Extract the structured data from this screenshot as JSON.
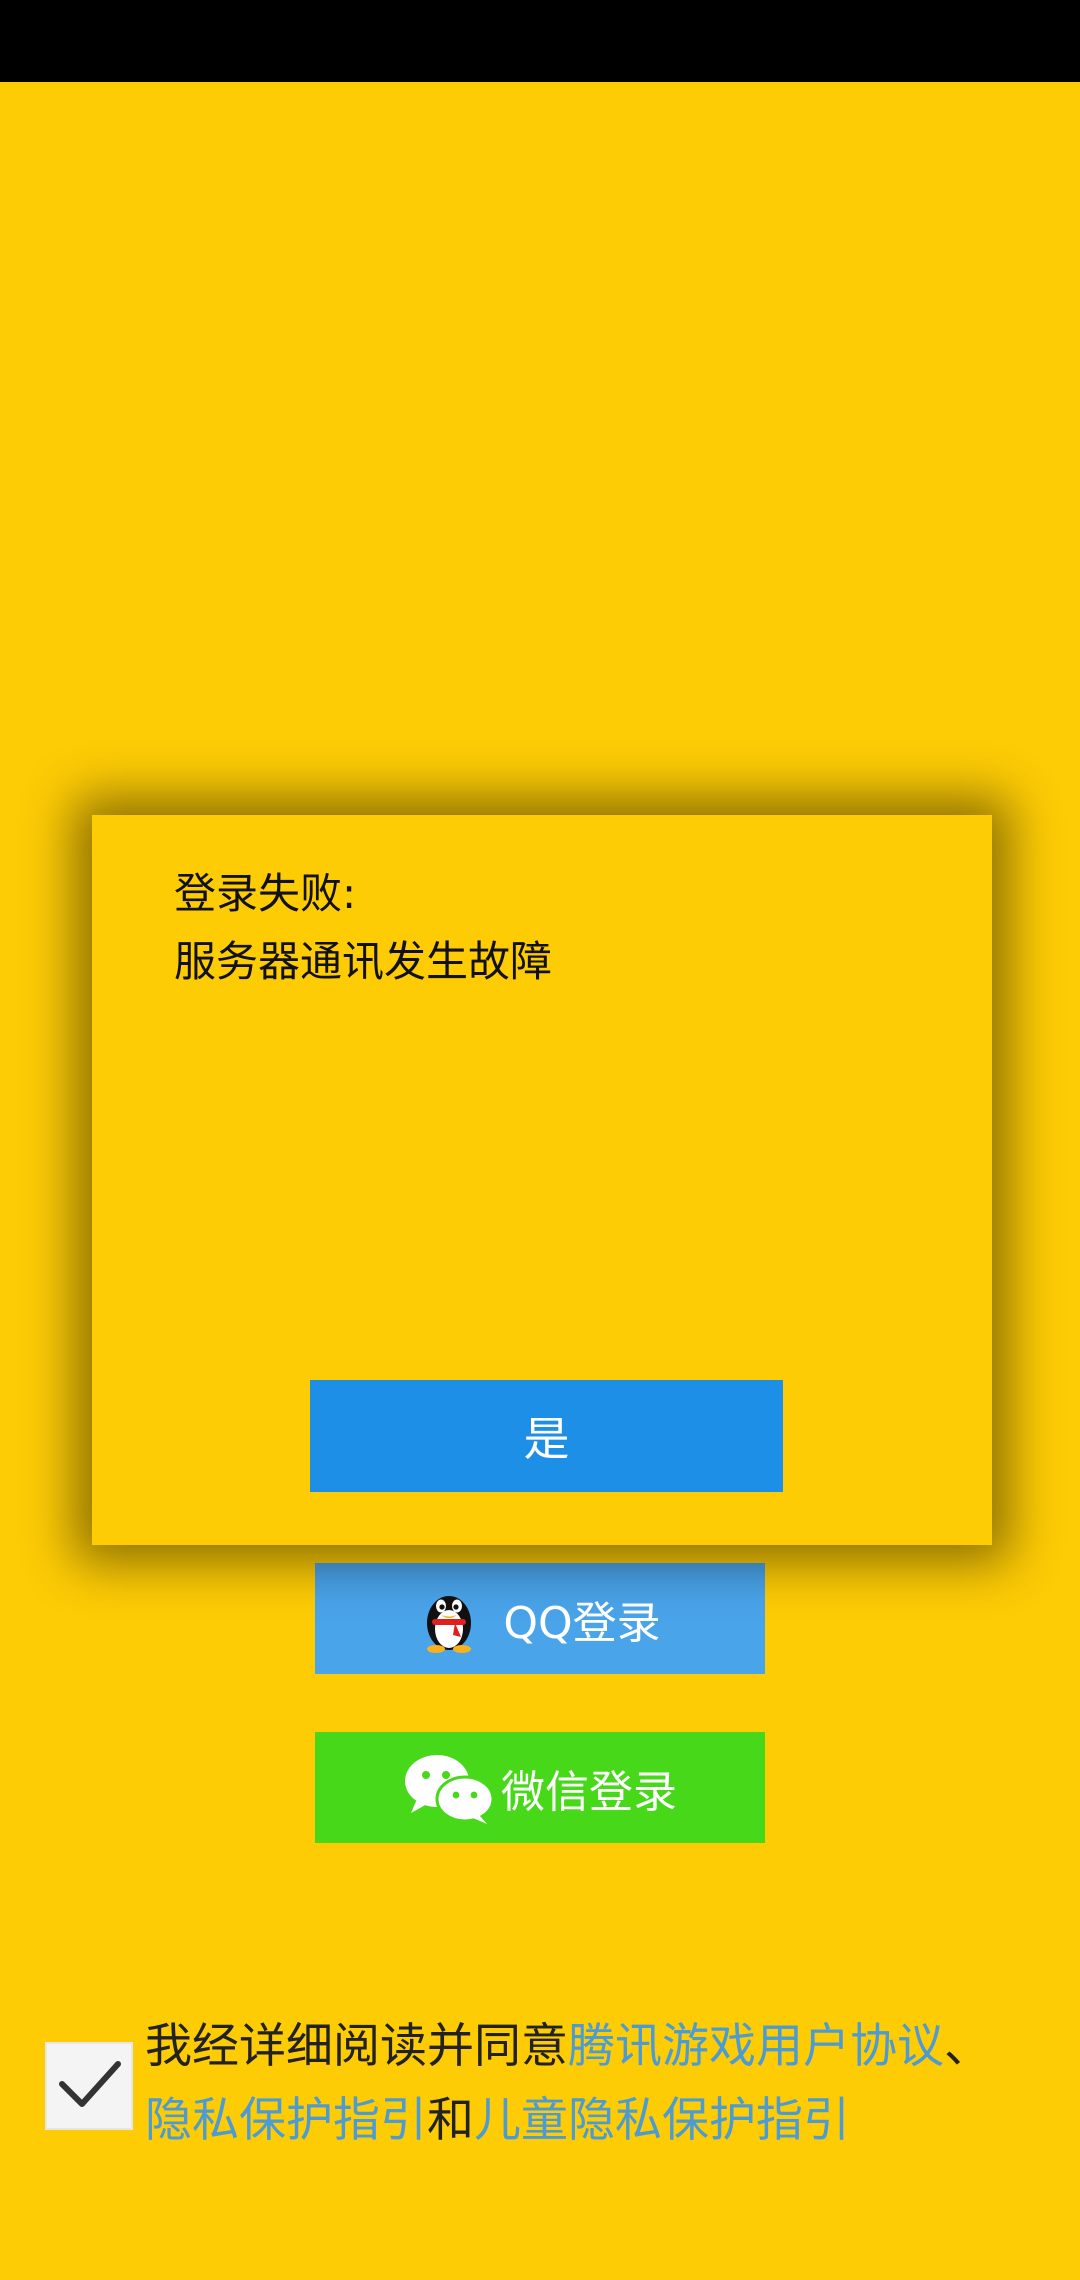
{
  "dialog": {
    "title": "登录失败:",
    "message": "服务器通讯发生故障",
    "confirm_label": "是"
  },
  "login": {
    "qq_label": "QQ登录",
    "wechat_label": "微信登录"
  },
  "agreement": {
    "checked": true,
    "prefix": "我经详细阅读并同意",
    "link_user_agreement": "腾讯游戏用户协议",
    "separator": "、",
    "link_privacy": "隐私保护指引",
    "conjunction": "和",
    "link_child_privacy": "儿童隐私保护指引"
  },
  "icons": {
    "qq": "qq-penguin-icon",
    "wechat": "wechat-icon",
    "check": "checkmark-icon"
  },
  "colors": {
    "background": "#FECC05",
    "qq_button": "#4AA4EA",
    "wechat_button": "#47D81A",
    "confirm_button": "#1E8FE6",
    "link": "#4D9BD3"
  }
}
